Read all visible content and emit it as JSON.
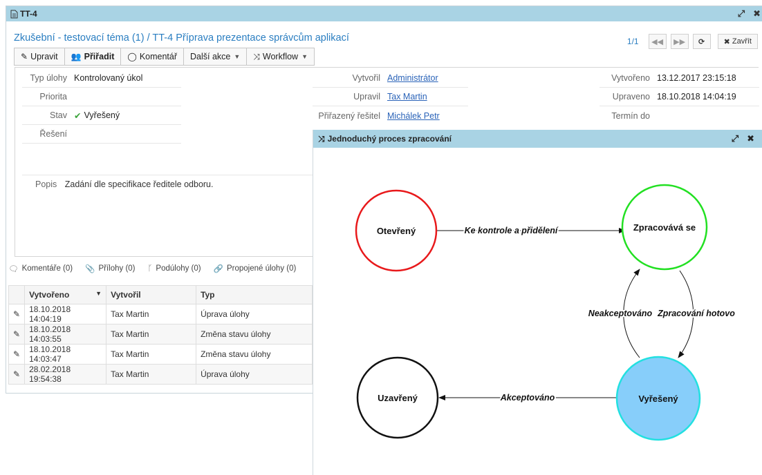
{
  "window": {
    "title": "TT-4",
    "heading": "Zkušební - testovací téma (1) / TT-4 Příprava prezentace správcům aplikací",
    "pager": "1/1",
    "close_label": "Zavřít"
  },
  "toolbar": {
    "edit": "Upravit",
    "assign": "Přiřadit",
    "comment": "Komentář",
    "more": "Další akce",
    "workflow": "Workflow"
  },
  "fields": {
    "type_label": "Typ úlohy",
    "type_value": "Kontrolovaný úkol",
    "priority_label": "Priorita",
    "state_label": "Stav",
    "state_value": "Vyřešený",
    "resolution_label": "Řešení",
    "created_by_label": "Vytvořil",
    "created_by_value": "Administrátor",
    "modified_by_label": "Upravil",
    "modified_by_value": "Tax Martin",
    "assignee_label": "Přiřazený řešitel",
    "assignee_value": "Michálek Petr",
    "created_label": "Vytvořeno",
    "created_value": "13.12.2017 23:15:18",
    "modified_label": "Upraveno",
    "modified_value": "18.10.2018 14:04:19",
    "due_label": "Termín do",
    "desc_label": "Popis",
    "desc_value": "Zadání dle specifikace ředitele odboru."
  },
  "tabs": [
    "Komentáře (0)",
    "Přílohy (0)",
    "Podúlohy (0)",
    "Propojené úlohy (0)"
  ],
  "history": {
    "columns": [
      "Vytvořeno",
      "Vytvořil",
      "Typ"
    ],
    "rows": [
      [
        "18.10.2018 14:04:19",
        "Tax Martin",
        "Úprava úlohy"
      ],
      [
        "18.10.2018 14:03:55",
        "Tax Martin",
        "Změna stavu úlohy"
      ],
      [
        "18.10.2018 14:03:47",
        "Tax Martin",
        "Změna stavu úlohy"
      ],
      [
        "28.02.2018 19:54:38",
        "Tax Martin",
        "Úprava úlohy"
      ]
    ]
  },
  "popup": {
    "title": "Jednoduchý proces zpracování",
    "states": {
      "open": "Otevřený",
      "processing": "Zpracovává se",
      "closed": "Uzavřený",
      "resolved": "Vyřešený"
    },
    "transitions": {
      "open_to_processing": "Ke kontrole a přidělení",
      "processing_to_resolved": "Zpracování hotovo",
      "resolved_to_processing": "Neakceptováno",
      "resolved_to_closed": "Akceptováno"
    },
    "colors": {
      "open": "#e8191b",
      "processing": "#22e022",
      "closed": "#111111",
      "resolved_stroke": "#22e0e0",
      "resolved_fill": "#87cefa"
    }
  }
}
